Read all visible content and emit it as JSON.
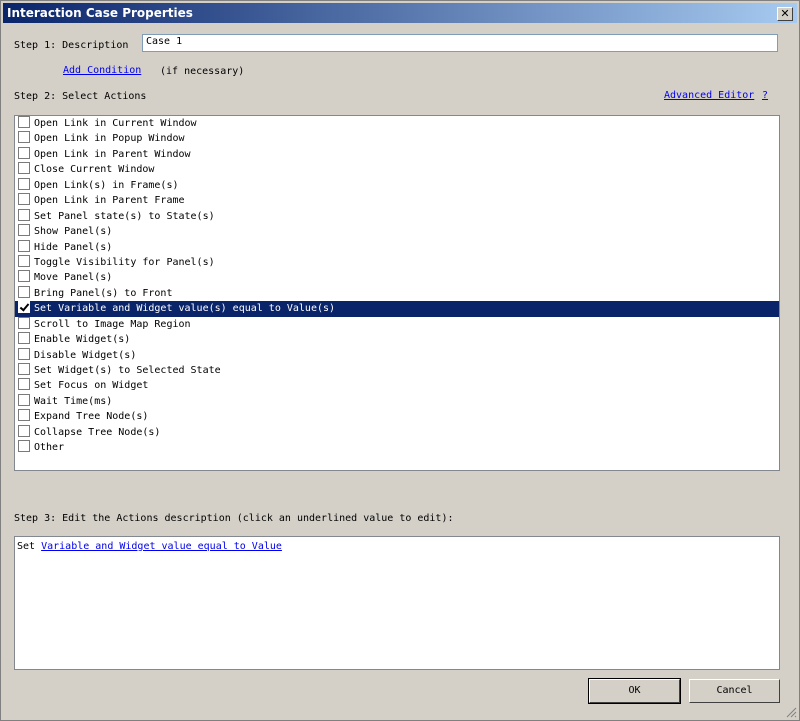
{
  "window": {
    "title": "Interaction Case Properties",
    "close_glyph": "✕"
  },
  "step1": {
    "label": "Step 1: Description",
    "value": "Case 1",
    "add_condition": "Add Condition",
    "if_necessary": "(if necessary)"
  },
  "step2": {
    "label": "Step 2: Select Actions",
    "advanced_editor": "Advanced Editor",
    "help": "?",
    "actions": [
      {
        "label": "Open Link in Current Window",
        "checked": false
      },
      {
        "label": "Open Link in Popup Window",
        "checked": false
      },
      {
        "label": "Open Link in Parent Window",
        "checked": false
      },
      {
        "label": "Close Current Window",
        "checked": false
      },
      {
        "label": "Open Link(s) in Frame(s)",
        "checked": false
      },
      {
        "label": "Open Link in Parent Frame",
        "checked": false
      },
      {
        "label": "Set Panel state(s) to State(s)",
        "checked": false
      },
      {
        "label": "Show Panel(s)",
        "checked": false
      },
      {
        "label": "Hide Panel(s)",
        "checked": false
      },
      {
        "label": "Toggle Visibility for Panel(s)",
        "checked": false
      },
      {
        "label": "Move Panel(s)",
        "checked": false
      },
      {
        "label": "Bring Panel(s) to Front",
        "checked": false
      },
      {
        "label": "Set Variable and Widget value(s) equal to Value(s)",
        "checked": true
      },
      {
        "label": "Scroll to Image Map Region",
        "checked": false
      },
      {
        "label": "Enable Widget(s)",
        "checked": false
      },
      {
        "label": "Disable Widget(s)",
        "checked": false
      },
      {
        "label": "Set Widget(s) to Selected State",
        "checked": false
      },
      {
        "label": "Set Focus on Widget",
        "checked": false
      },
      {
        "label": "Wait Time(ms)",
        "checked": false
      },
      {
        "label": "Expand Tree Node(s)",
        "checked": false
      },
      {
        "label": "Collapse Tree Node(s)",
        "checked": false
      },
      {
        "label": "Other",
        "checked": false
      }
    ]
  },
  "step3": {
    "label": "Step 3: Edit the Actions description (click an underlined value to edit):",
    "prefix": "Set ",
    "link": "Variable and Widget value equal to Value"
  },
  "buttons": {
    "ok": "OK",
    "cancel": "Cancel"
  }
}
